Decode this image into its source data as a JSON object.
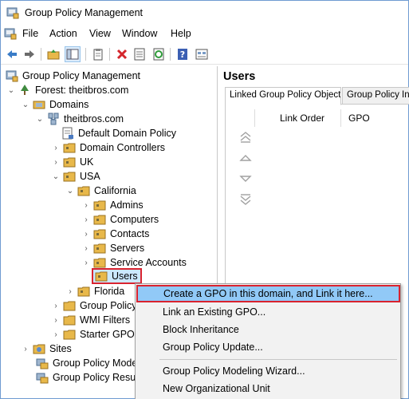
{
  "window": {
    "title": "Group Policy Management"
  },
  "menu": [
    "File",
    "Action",
    "View",
    "Window",
    "Help"
  ],
  "toolbar": {
    "buttons": [
      "back-icon",
      "forward-icon",
      "up-folder-icon",
      "show-hide-tree-icon",
      "clipboard-icon",
      "delete-icon",
      "properties-icon",
      "refresh-icon",
      "help-icon",
      "console-icon"
    ]
  },
  "tree": {
    "root": "Group Policy Management",
    "forest": "Forest: theitbros.com",
    "domains": "Domains",
    "domain": "theitbros.com",
    "default_policy": "Default Domain Policy",
    "domain_controllers": "Domain Controllers",
    "uk": "UK",
    "usa": "USA",
    "california": "California",
    "admins": "Admins",
    "computers": "Computers",
    "contacts": "Contacts",
    "servers": "Servers",
    "service_accounts": "Service Accounts",
    "users": "Users",
    "florida": "Florida",
    "group_policy_objects": "Group Policy",
    "wmi_filters": "WMI Filters",
    "starter_gpos": "Starter GPOs",
    "sites": "Sites",
    "modeling": "Group Policy Mode",
    "results": "Group Policy Result"
  },
  "right": {
    "title": "Users",
    "tab_active": "Linked Group Policy Objects",
    "tab_other": "Group Policy Inhe",
    "col_link_order": "Link Order",
    "col_gpo": "GPO"
  },
  "context_menu": {
    "create_link": "Create a GPO in this domain, and Link it here...",
    "link_existing": "Link an Existing GPO...",
    "block_inheritance": "Block Inheritance",
    "gp_update": "Group Policy Update...",
    "modeling_wizard": "Group Policy Modeling Wizard...",
    "new_ou": "New Organizational Unit"
  },
  "colors": {
    "highlight_border": "#d9232f",
    "menu_highlight": "#91c9f7",
    "folder": "#e8b84a"
  }
}
